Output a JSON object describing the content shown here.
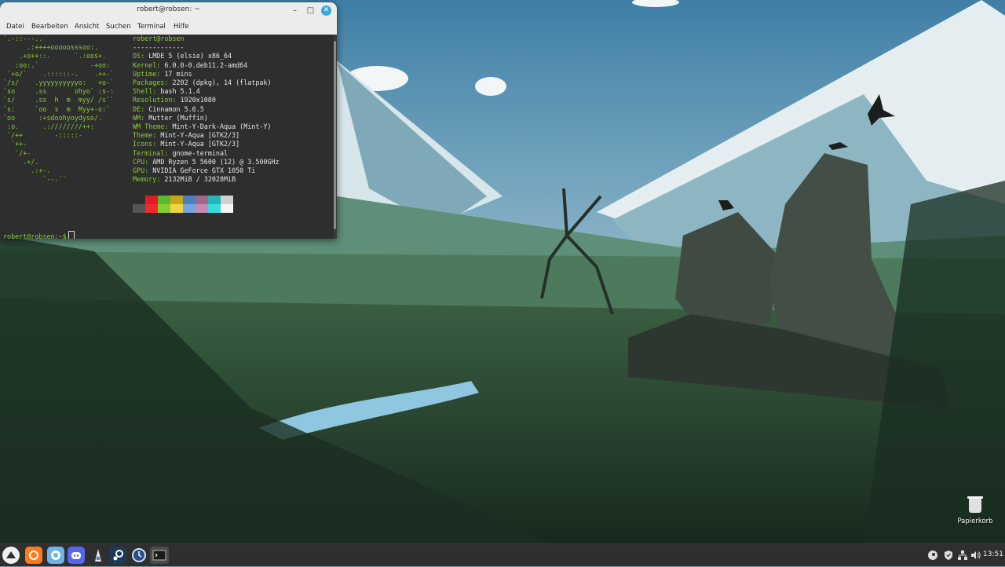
{
  "window": {
    "title": "robert@robsen: ~",
    "menu": [
      "Datei",
      "Bearbeiten",
      "Ansicht",
      "Suchen",
      "Terminal",
      "Hilfe"
    ]
  },
  "neofetch": {
    "user": "robert@robsen",
    "separator": "-------------",
    "ascii": [
      "`.-::---..",
      "      .:++++ooooosssoo:.",
      "    .+o++::.      `.:oos+.",
      "   :oo:.`             -+oo:",
      " `+o/`    .::::::-.    .++-`",
      "`/s/    .yyyyyyyyyyo:   +o-`",
      "`so     .ss       ohyo` :s-:",
      "`s/     .ss  h  m  myy/ /s``",
      "`s:     `oo  s  m  Myy+-o:`",
      "`oo      :+sdoohyoydyso/.",
      " :o.      .:////////++:",
      " `/++        -:::::-",
      "  `++-",
      "   `/+-",
      "     .+/.",
      "       .:+-.",
      "          `--.``"
    ],
    "info": [
      {
        "key": "OS",
        "value": "LMDE 5 (elsie) x86_64"
      },
      {
        "key": "Kernel",
        "value": "6.0.0-0.deb11.2-amd64"
      },
      {
        "key": "Uptime",
        "value": "17 mins"
      },
      {
        "key": "Packages",
        "value": "2202 (dpkg), 14 (flatpak)"
      },
      {
        "key": "Shell",
        "value": "bash 5.1.4"
      },
      {
        "key": "Resolution",
        "value": "1920x1080"
      },
      {
        "key": "DE",
        "value": "Cinnamon 5.6.5"
      },
      {
        "key": "WM",
        "value": "Mutter (Muffin)"
      },
      {
        "key": "WM Theme",
        "value": "Mint-Y-Dark-Aqua (Mint-Y)"
      },
      {
        "key": "Theme",
        "value": "Mint-Y-Aqua [GTK2/3]"
      },
      {
        "key": "Icons",
        "value": "Mint-Y-Aqua [GTK2/3]"
      },
      {
        "key": "Terminal",
        "value": "gnome-terminal"
      },
      {
        "key": "CPU",
        "value": "AMD Ryzen 5 5600 (12) @ 3.500GHz"
      },
      {
        "key": "GPU",
        "value": "NVIDIA GeForce GTX 1050 Ti"
      },
      {
        "key": "Memory",
        "value": "2132MiB / 32028MiB"
      }
    ],
    "swatches_top": [
      "#2e2e2e",
      "#e01b24",
      "#5cb82e",
      "#c8a418",
      "#4d7fc0",
      "#a2678c",
      "#24b5b5",
      "#d0d0d0"
    ],
    "swatches_bottom": [
      "#555555",
      "#f02a2a",
      "#87ce2f",
      "#f0d540",
      "#76a6e0",
      "#c68bb3",
      "#39dcdc",
      "#f4f4f4"
    ]
  },
  "prompt": "robert@robsen:~$",
  "desktop": {
    "trash_label": "Papierkorb"
  },
  "taskbar": {
    "apps": [
      "menu-icon",
      "firefox-icon",
      "files-icon",
      "discord-icon",
      "software-icon",
      "steam-icon",
      "timeshift-icon",
      "terminal-icon"
    ],
    "clock": "13:51"
  }
}
